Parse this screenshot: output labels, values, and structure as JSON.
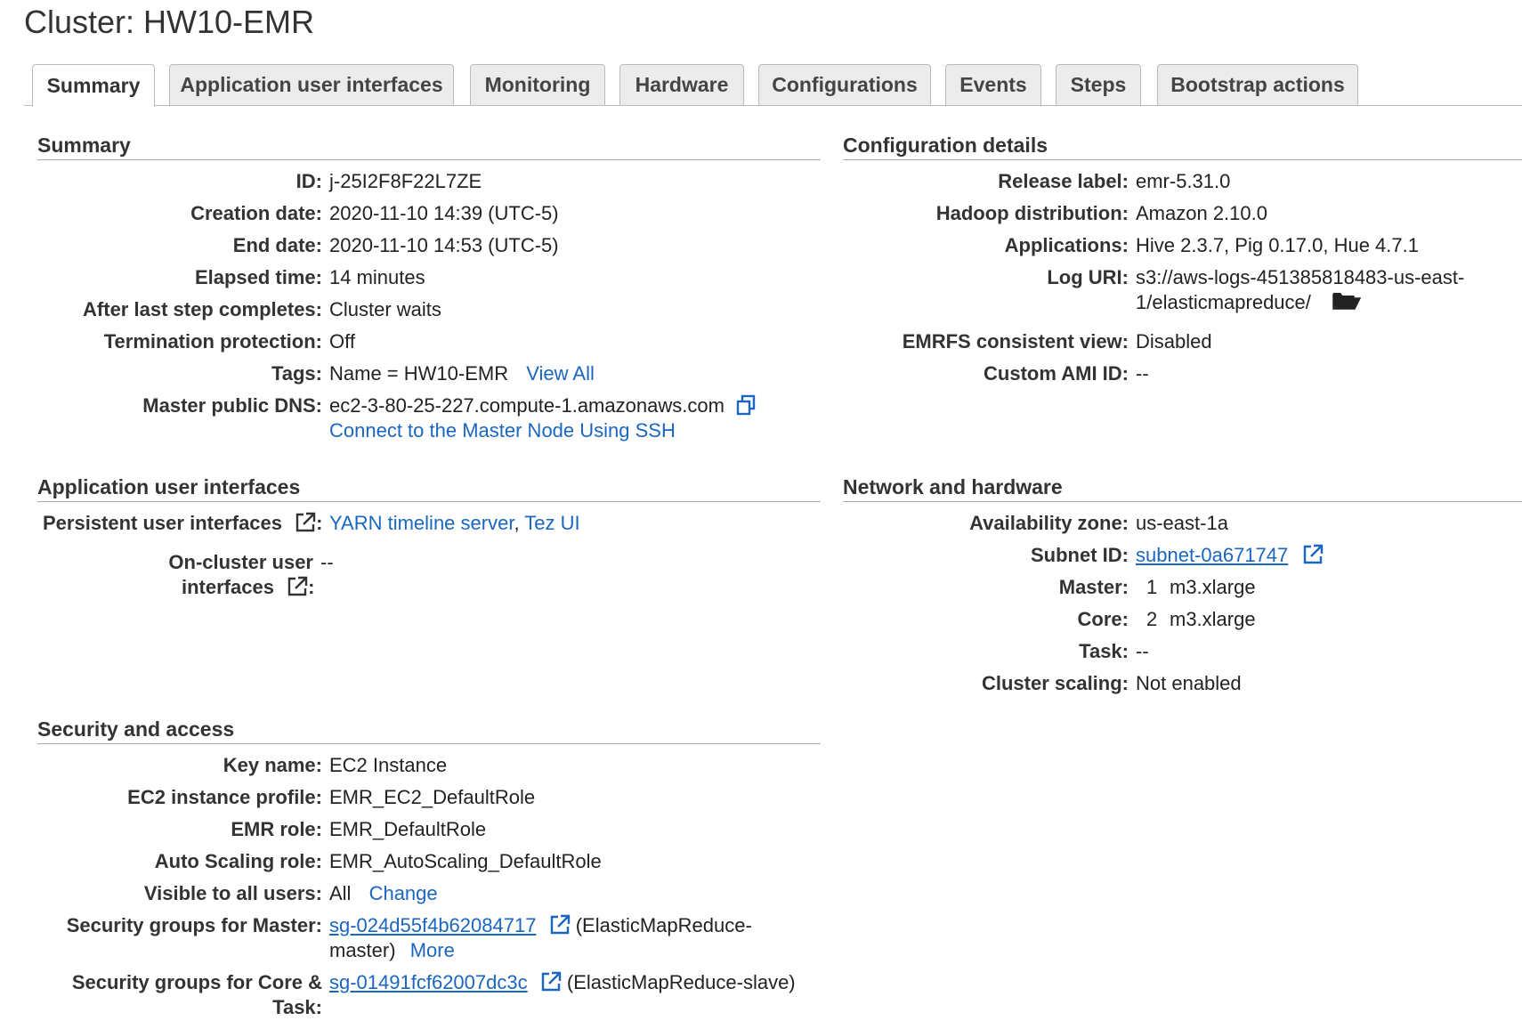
{
  "page": {
    "title": "Cluster: HW10-EMR"
  },
  "tabs": [
    {
      "label": "Summary",
      "active": true
    },
    {
      "label": "Application user interfaces",
      "active": false
    },
    {
      "label": "Monitoring",
      "active": false
    },
    {
      "label": "Hardware",
      "active": false
    },
    {
      "label": "Configurations",
      "active": false
    },
    {
      "label": "Events",
      "active": false
    },
    {
      "label": "Steps",
      "active": false
    },
    {
      "label": "Bootstrap actions",
      "active": false
    }
  ],
  "summary": {
    "title": "Summary",
    "id_label": "ID:",
    "id": "j-25I2F8F22L7ZE",
    "creation_label": "Creation date:",
    "creation": "2020-11-10 14:39 (UTC-5)",
    "end_label": "End date:",
    "end": "2020-11-10 14:53 (UTC-5)",
    "elapsed_label": "Elapsed time:",
    "elapsed": "14 minutes",
    "after_label": "After last step completes:",
    "after": "Cluster waits",
    "termination_label": "Termination protection:",
    "termination": "Off",
    "tags_label": "Tags:",
    "tags": "Name = HW10-EMR",
    "tags_link": "View All",
    "dns_label": "Master public DNS:",
    "dns": "ec2-3-80-25-227.compute-1.amazonaws.com",
    "ssh_link": "Connect to the Master Node Using SSH"
  },
  "config": {
    "title": "Configuration details",
    "release_label": "Release label:",
    "release": "emr-5.31.0",
    "hadoop_label": "Hadoop distribution:",
    "hadoop": "Amazon 2.10.0",
    "apps_label": "Applications:",
    "apps": "Hive 2.3.7, Pig 0.17.0, Hue 4.7.1",
    "log_label": "Log URI:",
    "log_line1": "s3://aws-logs-451385818483-us-east-",
    "log_line2": "1/elasticmapreduce/",
    "emrfs_label": "EMRFS consistent view:",
    "emrfs": "Disabled",
    "ami_label": "Custom AMI ID:",
    "ami": "--"
  },
  "app_ui": {
    "title": "Application user interfaces",
    "persistent_label": "Persistent user interfaces",
    "persistent_colon": ":",
    "yarn_link": "YARN timeline server",
    "comma": ",",
    "tez_link": "Tez UI",
    "oncluster_label_1": "On-cluster user",
    "oncluster_label_2": "interfaces",
    "oncluster_colon": ":",
    "oncluster_value": "--"
  },
  "network": {
    "title": "Network and hardware",
    "az_label": "Availability zone:",
    "az": "us-east-1a",
    "subnet_label": "Subnet ID:",
    "subnet": "subnet-0a671747",
    "master_label": "Master:",
    "master_count": "1",
    "master_type": "m3.xlarge",
    "core_label": "Core:",
    "core_count": "2",
    "core_type": "m3.xlarge",
    "task_label": "Task:",
    "task": "--",
    "scaling_label": "Cluster scaling:",
    "scaling": "Not enabled"
  },
  "security": {
    "title": "Security and access",
    "key_label": "Key name:",
    "key": "EC2 Instance",
    "profile_label": "EC2 instance profile:",
    "profile": "EMR_EC2_DefaultRole",
    "role_label": "EMR role:",
    "role": "EMR_DefaultRole",
    "autoscale_label": "Auto Scaling role:",
    "autoscale": "EMR_AutoScaling_DefaultRole",
    "visible_label": "Visible to all users:",
    "visible": "All",
    "visible_link": "Change",
    "sgm_label": "Security groups for Master:",
    "sgm_link": "sg-024d55f4b62084717",
    "sgm_line1": "(ElasticMapReduce-",
    "sgm_line2": "master)",
    "sgm_more": "More",
    "sgc_label_1": "Security groups for Core &",
    "sgc_label_2": "Task:",
    "sgc_link": "sg-01491fcf62007dc3c",
    "sgc_desc": "(ElasticMapReduce-slave)"
  },
  "icons": {
    "copy": "copy-icon",
    "folder": "folder-open-icon",
    "external": "external-link-icon"
  },
  "colors": {
    "link": "#1a66c0",
    "text": "#222222"
  }
}
